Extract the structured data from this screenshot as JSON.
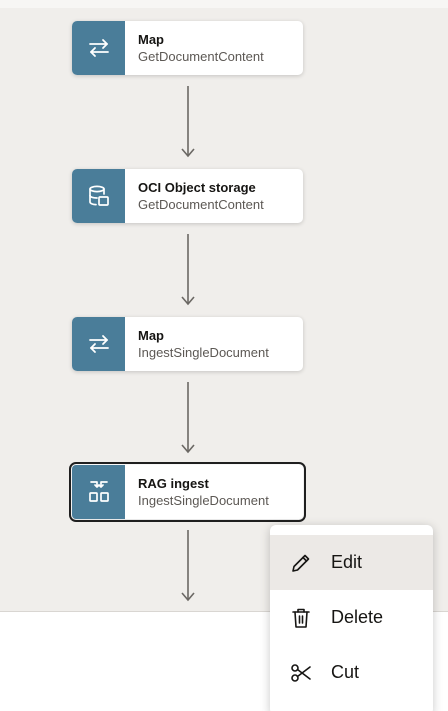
{
  "flow": {
    "nodes": [
      {
        "title": "Map",
        "subtitle": "GetDocumentContent",
        "icon": "map-arrows-icon"
      },
      {
        "title": "OCI Object storage",
        "subtitle": "GetDocumentContent",
        "icon": "object-storage-icon"
      },
      {
        "title": "Map",
        "subtitle": "IngestSingleDocument",
        "icon": "map-arrows-icon"
      },
      {
        "title": "RAG ingest",
        "subtitle": "IngestSingleDocument",
        "icon": "rag-ingest-icon",
        "selected": true
      }
    ]
  },
  "context_menu": {
    "items": [
      {
        "label": "Edit",
        "icon": "pencil-icon",
        "highlighted": true
      },
      {
        "label": "Delete",
        "icon": "trash-icon"
      },
      {
        "label": "Cut",
        "icon": "scissors-icon"
      }
    ]
  },
  "colors": {
    "node_icon_bg": "#4a7d99",
    "canvas_bg": "#f0eeeb",
    "selected_border": "#1f1f1f",
    "connector": "#6b6864"
  }
}
